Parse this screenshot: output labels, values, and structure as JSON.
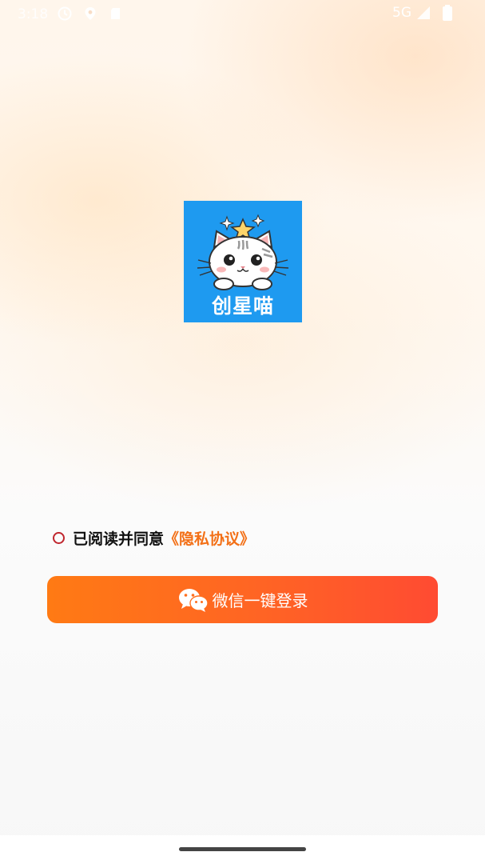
{
  "status_bar": {
    "time": "3:18",
    "network": "5G",
    "icons": [
      "clock-icon",
      "location-icon",
      "sd-card-icon",
      "signal-icon",
      "battery-icon"
    ]
  },
  "app": {
    "logo_text": "创星喵",
    "logo_bg_color": "#1e9af0"
  },
  "agreement": {
    "prefix": "已阅读并同意",
    "link": "《隐私协议》",
    "checked": false,
    "link_color": "#f37017"
  },
  "login": {
    "label": "微信一键登录",
    "icon": "wechat-icon",
    "gradient": [
      "#ff7a14",
      "#ff4b32"
    ]
  }
}
